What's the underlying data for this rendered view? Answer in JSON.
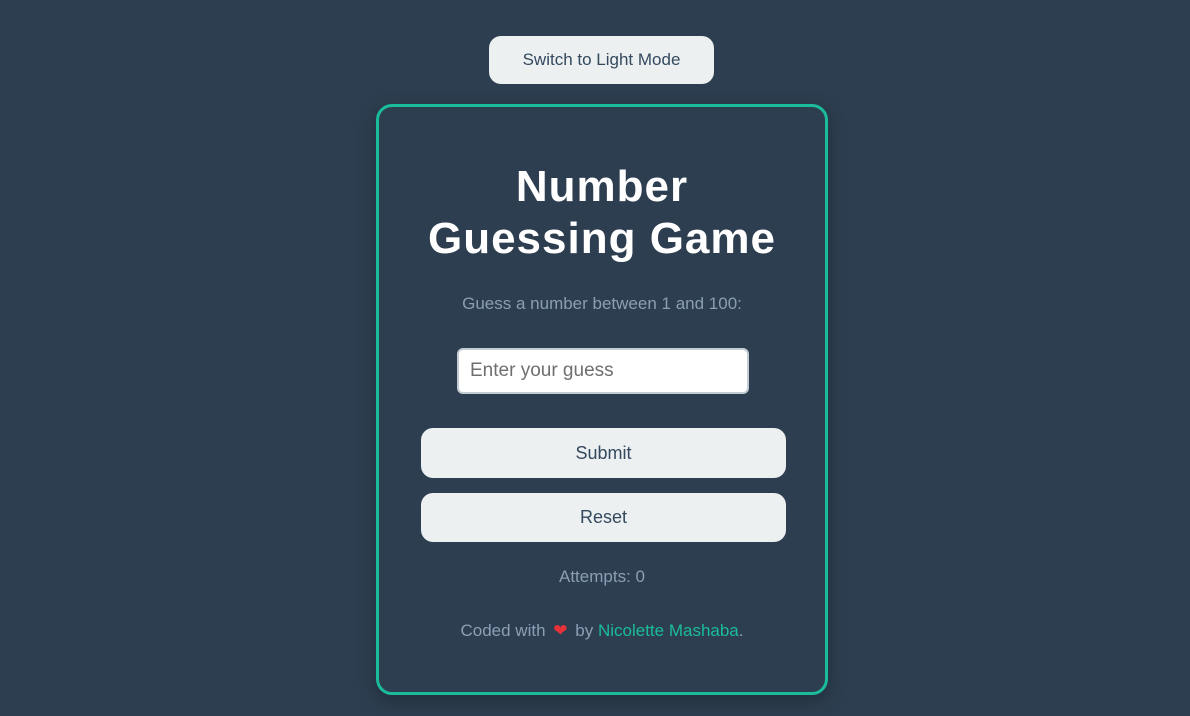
{
  "header": {
    "theme_toggle_label": "Switch to Light Mode"
  },
  "game": {
    "title_line1": "Number",
    "title_line2": "Guessing Game",
    "instruction": "Guess a number between 1 and 100:",
    "guess_input": {
      "value": "",
      "placeholder": "Enter your guess"
    },
    "submit_label": "Submit",
    "reset_label": "Reset",
    "attempts_label": "Attempts:",
    "attempts_count": "0"
  },
  "footer": {
    "prefix": "Coded with",
    "heart_icon": "heart-icon",
    "by": "by",
    "author": "Nicolette Mashaba",
    "suffix": "."
  },
  "colors": {
    "background": "#2d3e50",
    "accent": "#1abc9c",
    "button_bg": "#ecf0f1",
    "button_text": "#34495e",
    "heart": "#e8323a"
  }
}
